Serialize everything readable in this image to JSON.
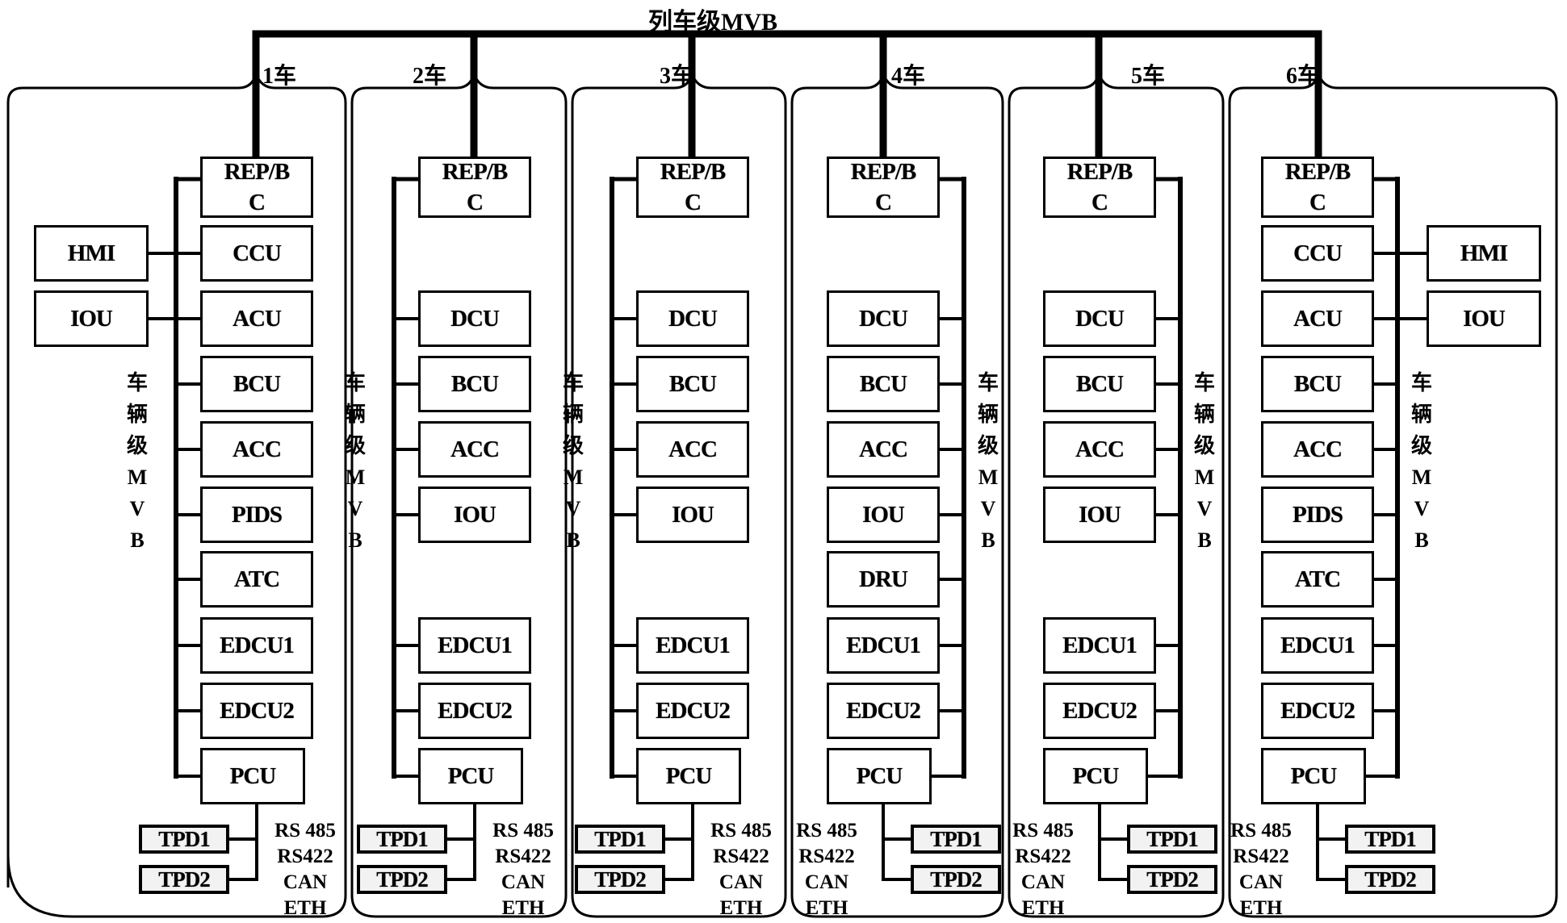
{
  "title": "列车级MVB",
  "vehicle_bus_label": [
    "车",
    "辆",
    "级",
    "M",
    "V",
    "B"
  ],
  "protocols": [
    "RS 485",
    "RS422",
    "CAN",
    "ETH"
  ],
  "cars": [
    {
      "label": "1车",
      "gateway": [
        "REP/B",
        "C"
      ],
      "bus_side": "left",
      "modules": [
        {
          "row": 1,
          "name": "CCU"
        },
        {
          "row": 2,
          "name": "ACU"
        },
        {
          "row": 3,
          "name": "BCU"
        },
        {
          "row": 4,
          "name": "ACC"
        },
        {
          "row": 5,
          "name": "PIDS"
        },
        {
          "row": 6,
          "name": "ATC"
        },
        {
          "row": 7,
          "name": "EDCU1"
        },
        {
          "row": 8,
          "name": "EDCU2"
        },
        {
          "row": 9,
          "name": "PCU"
        }
      ],
      "side_modules": [
        {
          "row": 1,
          "name": "HMI"
        },
        {
          "row": 2,
          "name": "IOU"
        }
      ],
      "tpd": [
        "TPD1",
        "TPD2"
      ],
      "tpd_side": "left"
    },
    {
      "label": "2车",
      "gateway": [
        "REP/B",
        "C"
      ],
      "bus_side": "left",
      "modules": [
        {
          "row": 2,
          "name": "DCU"
        },
        {
          "row": 3,
          "name": "BCU"
        },
        {
          "row": 4,
          "name": "ACC"
        },
        {
          "row": 5,
          "name": "IOU"
        },
        {
          "row": 7,
          "name": "EDCU1"
        },
        {
          "row": 8,
          "name": "EDCU2"
        },
        {
          "row": 9,
          "name": "PCU"
        }
      ],
      "side_modules": [],
      "tpd": [
        "TPD1",
        "TPD2"
      ],
      "tpd_side": "left"
    },
    {
      "label": "3车",
      "gateway": [
        "REP/B",
        "C"
      ],
      "bus_side": "left",
      "modules": [
        {
          "row": 2,
          "name": "DCU"
        },
        {
          "row": 3,
          "name": "BCU"
        },
        {
          "row": 4,
          "name": "ACC"
        },
        {
          "row": 5,
          "name": "IOU"
        },
        {
          "row": 7,
          "name": "EDCU1"
        },
        {
          "row": 8,
          "name": "EDCU2"
        },
        {
          "row": 9,
          "name": "PCU"
        }
      ],
      "side_modules": [],
      "tpd": [
        "TPD1",
        "TPD2"
      ],
      "tpd_side": "left"
    },
    {
      "label": "4车",
      "gateway": [
        "REP/B",
        "C"
      ],
      "bus_side": "right",
      "modules": [
        {
          "row": 2,
          "name": "DCU"
        },
        {
          "row": 3,
          "name": "BCU"
        },
        {
          "row": 4,
          "name": "ACC"
        },
        {
          "row": 5,
          "name": "IOU"
        },
        {
          "row": 6,
          "name": "DRU"
        },
        {
          "row": 7,
          "name": "EDCU1"
        },
        {
          "row": 8,
          "name": "EDCU2"
        },
        {
          "row": 9,
          "name": "PCU"
        }
      ],
      "side_modules": [],
      "tpd": [
        "TPD1",
        "TPD2"
      ],
      "tpd_side": "right"
    },
    {
      "label": "5车",
      "gateway": [
        "REP/B",
        "C"
      ],
      "bus_side": "right",
      "modules": [
        {
          "row": 2,
          "name": "DCU"
        },
        {
          "row": 3,
          "name": "BCU"
        },
        {
          "row": 4,
          "name": "ACC"
        },
        {
          "row": 5,
          "name": "IOU"
        },
        {
          "row": 7,
          "name": "EDCU1"
        },
        {
          "row": 8,
          "name": "EDCU2"
        },
        {
          "row": 9,
          "name": "PCU"
        }
      ],
      "side_modules": [],
      "tpd": [
        "TPD1",
        "TPD2"
      ],
      "tpd_side": "right"
    },
    {
      "label": "6车",
      "gateway": [
        "REP/B",
        "C"
      ],
      "bus_side": "right",
      "modules": [
        {
          "row": 1,
          "name": "CCU"
        },
        {
          "row": 2,
          "name": "ACU"
        },
        {
          "row": 3,
          "name": "BCU"
        },
        {
          "row": 4,
          "name": "ACC"
        },
        {
          "row": 5,
          "name": "PIDS"
        },
        {
          "row": 6,
          "name": "ATC"
        },
        {
          "row": 7,
          "name": "EDCU1"
        },
        {
          "row": 8,
          "name": "EDCU2"
        },
        {
          "row": 9,
          "name": "PCU"
        }
      ],
      "side_modules": [
        {
          "row": 1,
          "name": "HMI"
        },
        {
          "row": 2,
          "name": "IOU"
        }
      ],
      "tpd": [
        "TPD1",
        "TPD2"
      ],
      "tpd_side": "right"
    }
  ]
}
